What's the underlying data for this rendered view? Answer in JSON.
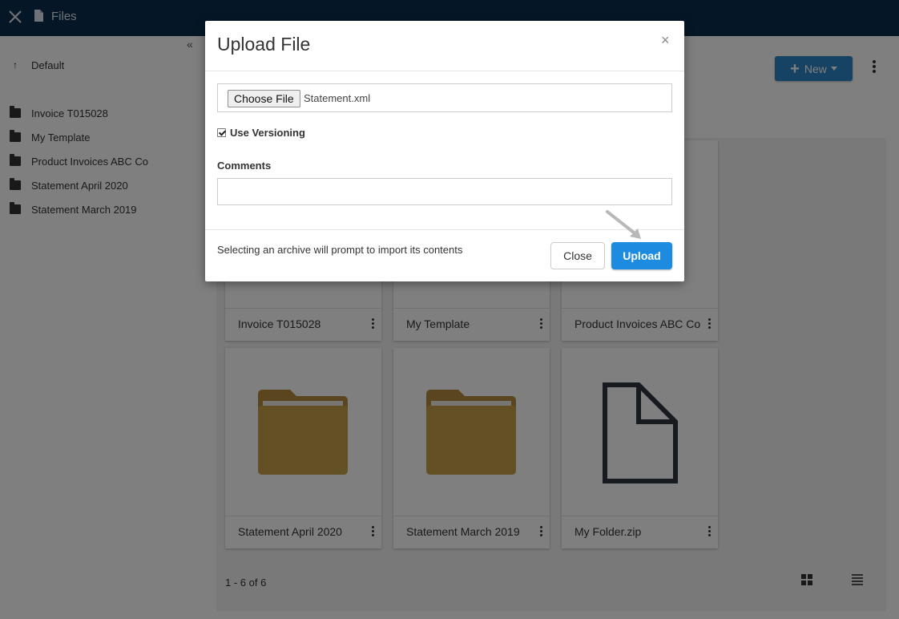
{
  "topbar": {
    "title": "Files"
  },
  "sidebar": {
    "collapse": "«",
    "up_item": "Default",
    "items": [
      {
        "label": "Invoice T015028"
      },
      {
        "label": "My Template"
      },
      {
        "label": "Product Invoices ABC Co"
      },
      {
        "label": "Statement April 2020"
      },
      {
        "label": "Statement March 2019"
      }
    ]
  },
  "toolbar": {
    "new_label": "New"
  },
  "grid": {
    "cards": [
      {
        "label": "Invoice T015028",
        "type": "folder"
      },
      {
        "label": "My Template",
        "type": "folder"
      },
      {
        "label": "Product Invoices ABC Co",
        "type": "folder"
      },
      {
        "label": "Statement April 2020",
        "type": "folder"
      },
      {
        "label": "Statement March 2019",
        "type": "folder"
      },
      {
        "label": "My Folder.zip",
        "type": "file"
      }
    ],
    "pagination": "1 - 6 of 6"
  },
  "modal": {
    "title": "Upload File",
    "close_symbol": "×",
    "choose_file_label": "Choose File",
    "file_name": "Statement.xml",
    "use_versioning_label": "Use Versioning",
    "use_versioning_checked": true,
    "comments_label": "Comments",
    "comments_value": "",
    "footer_note": "Selecting an archive will prompt to import its contents",
    "close_button": "Close",
    "upload_button": "Upload"
  },
  "colors": {
    "topbar_bg": "#0b2f4e",
    "primary": "#1c8be0",
    "folder": "#c9a04a"
  }
}
